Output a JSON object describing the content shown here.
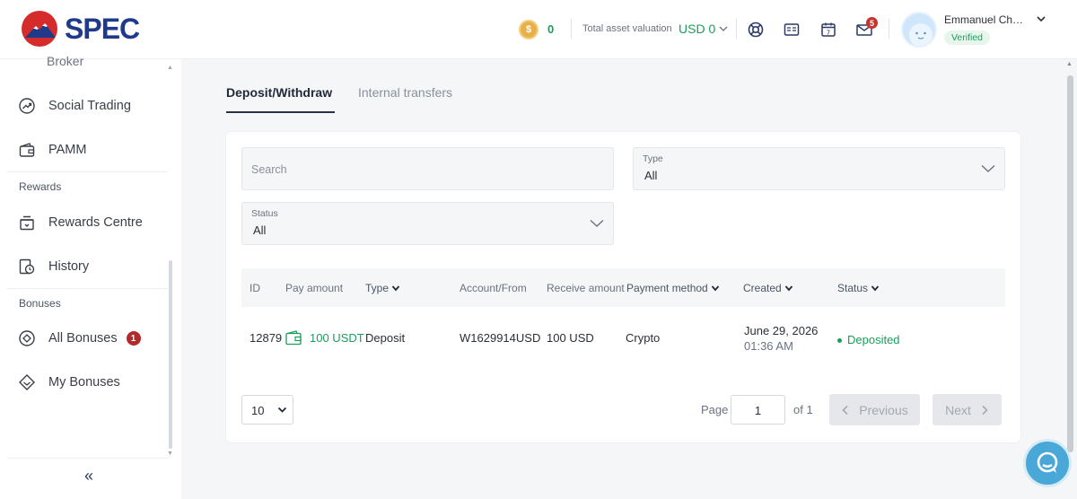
{
  "brand": {
    "name": "SPEC"
  },
  "header": {
    "coin_count": "0",
    "asset_label": "Total asset valuation",
    "asset_value": "USD 0",
    "mail_badge": "5",
    "user_name": "Emmanuel Chin...",
    "verified": "Verified",
    "icons": [
      "support-icon",
      "id-card-icon",
      "calendar-icon",
      "mail-icon"
    ]
  },
  "sidebar": {
    "partial_item": "Broker",
    "items": [
      {
        "label": "Social Trading"
      },
      {
        "label": "PAMM"
      }
    ],
    "rewards_section": "Rewards",
    "rewards_items": [
      {
        "label": "Rewards Centre"
      },
      {
        "label": "History"
      }
    ],
    "bonuses_section": "Bonuses",
    "bonuses_items": [
      {
        "label": "All Bonuses",
        "badge": "1"
      },
      {
        "label": "My Bonuses"
      }
    ],
    "collapse": "«"
  },
  "tabs": [
    {
      "label": "Deposit/Withdraw",
      "active": true
    },
    {
      "label": "Internal transfers",
      "active": false
    }
  ],
  "filters": {
    "search_placeholder": "Search",
    "type_label": "Type",
    "type_value": "All",
    "status_label": "Status",
    "status_value": "All"
  },
  "table": {
    "columns": [
      "ID",
      "Pay amount",
      "Type",
      "Account/From",
      "Receive amount",
      "Payment method",
      "Created",
      "Status"
    ],
    "rows": [
      {
        "id": "12879",
        "pay_amount": "100 USDT",
        "type": "Deposit",
        "account": "W1629914USD",
        "receive_amount": "100 USD",
        "payment_method": "Crypto",
        "created_date": "June 29, 2026",
        "created_time": "01:36 AM",
        "status": "Deposited"
      }
    ]
  },
  "pagination": {
    "page_size": "10",
    "page_label": "Page",
    "current_page": "1",
    "of_label": "of 1",
    "previous": "Previous",
    "next": "Next"
  },
  "colors": {
    "accent_green": "#1a9e5a",
    "brand_blue": "#1f3a8a",
    "brand_red": "#d62b2b"
  }
}
